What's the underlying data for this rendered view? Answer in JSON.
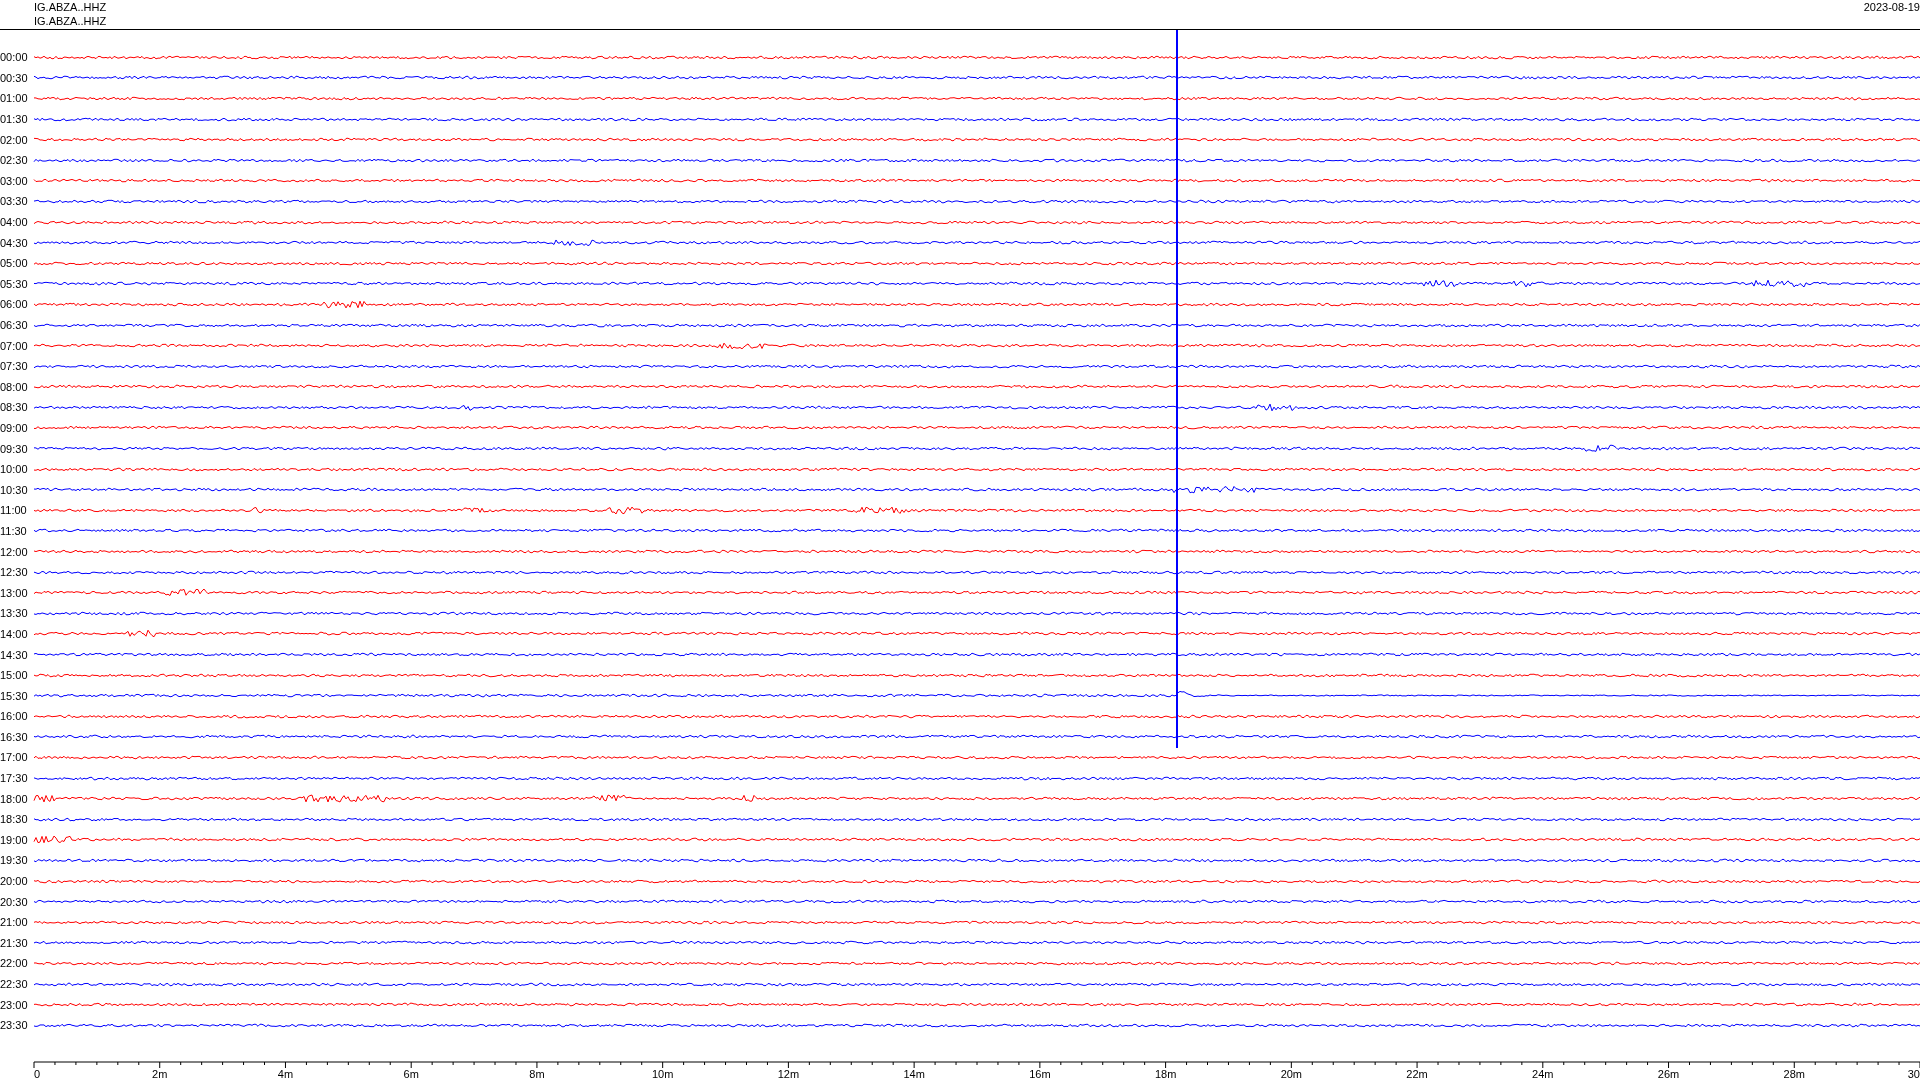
{
  "header": {
    "titles": [
      "IG.ABZA..HHZ",
      "IG.ABZA..HHZ"
    ],
    "date": "2023-08-19"
  },
  "rows": [
    {
      "time": "00:00",
      "color": "#ff0000"
    },
    {
      "time": "00:30",
      "color": "#0000ff"
    },
    {
      "time": "01:00",
      "color": "#ff0000"
    },
    {
      "time": "01:30",
      "color": "#0000ff"
    },
    {
      "time": "02:00",
      "color": "#ff0000"
    },
    {
      "time": "02:30",
      "color": "#0000ff"
    },
    {
      "time": "03:00",
      "color": "#ff0000"
    },
    {
      "time": "03:30",
      "color": "#0000ff"
    },
    {
      "time": "04:00",
      "color": "#ff0000"
    },
    {
      "time": "04:30",
      "color": "#0000ff"
    },
    {
      "time": "05:00",
      "color": "#ff0000"
    },
    {
      "time": "05:30",
      "color": "#0000ff"
    },
    {
      "time": "06:00",
      "color": "#ff0000"
    },
    {
      "time": "06:30",
      "color": "#0000ff"
    },
    {
      "time": "07:00",
      "color": "#ff0000"
    },
    {
      "time": "07:30",
      "color": "#0000ff"
    },
    {
      "time": "08:00",
      "color": "#ff0000"
    },
    {
      "time": "08:30",
      "color": "#0000ff"
    },
    {
      "time": "09:00",
      "color": "#ff0000"
    },
    {
      "time": "09:30",
      "color": "#0000ff"
    },
    {
      "time": "10:00",
      "color": "#ff0000"
    },
    {
      "time": "10:30",
      "color": "#0000ff"
    },
    {
      "time": "11:00",
      "color": "#ff0000"
    },
    {
      "time": "11:30",
      "color": "#0000ff"
    },
    {
      "time": "12:00",
      "color": "#ff0000"
    },
    {
      "time": "12:30",
      "color": "#0000ff"
    },
    {
      "time": "13:00",
      "color": "#ff0000"
    },
    {
      "time": "13:30",
      "color": "#0000ff"
    },
    {
      "time": "14:00",
      "color": "#ff0000"
    },
    {
      "time": "14:30",
      "color": "#0000ff"
    },
    {
      "time": "15:00",
      "color": "#ff0000"
    },
    {
      "time": "15:30",
      "color": "#0000ff"
    },
    {
      "time": "16:00",
      "color": "#ff0000"
    },
    {
      "time": "16:30",
      "color": "#0000ff"
    },
    {
      "time": "17:00",
      "color": "#ff0000"
    },
    {
      "time": "17:30",
      "color": "#0000ff"
    },
    {
      "time": "18:00",
      "color": "#ff0000"
    },
    {
      "time": "18:30",
      "color": "#0000ff"
    },
    {
      "time": "19:00",
      "color": "#ff0000"
    },
    {
      "time": "19:30",
      "color": "#0000ff"
    },
    {
      "time": "20:00",
      "color": "#ff0000"
    },
    {
      "time": "20:30",
      "color": "#0000ff"
    },
    {
      "time": "21:00",
      "color": "#ff0000"
    },
    {
      "time": "21:30",
      "color": "#0000ff"
    },
    {
      "time": "22:00",
      "color": "#ff0000"
    },
    {
      "time": "22:30",
      "color": "#0000ff"
    },
    {
      "time": "23:00",
      "color": "#ff0000"
    },
    {
      "time": "23:30",
      "color": "#0000ff"
    }
  ],
  "x_axis": {
    "ticks": [
      "0",
      "2m",
      "4m",
      "6m",
      "8m",
      "10m",
      "12m",
      "14m",
      "16m",
      "18m",
      "20m",
      "22m",
      "24m",
      "26m",
      "28m",
      "30"
    ]
  }
}
